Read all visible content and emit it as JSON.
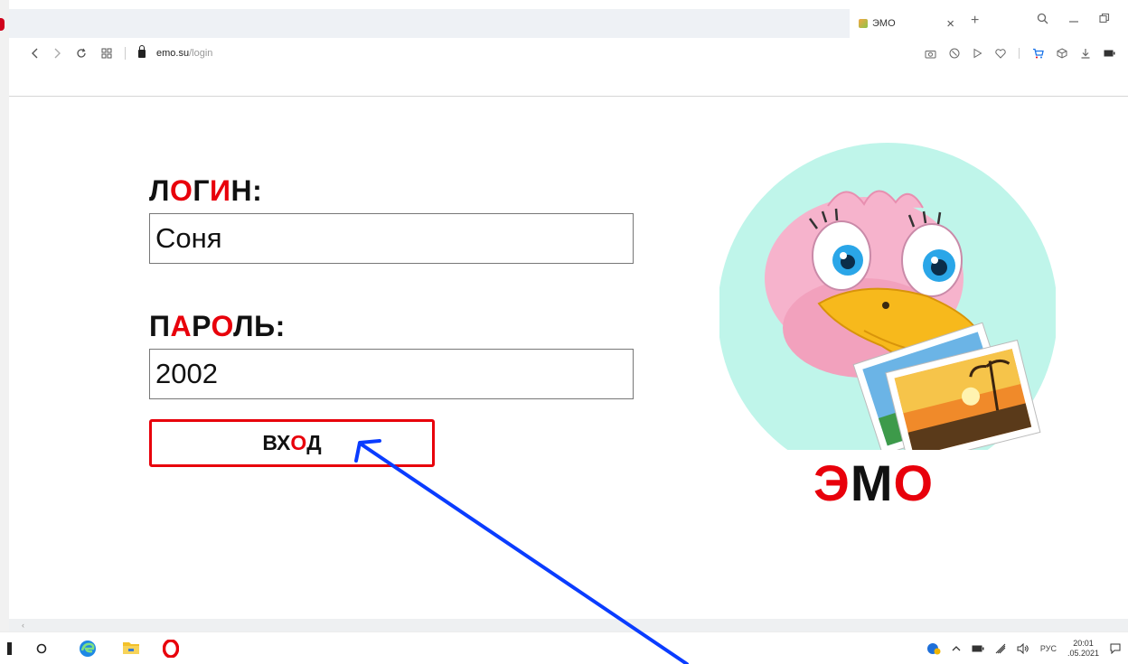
{
  "browser": {
    "tab_title": "ЭМО",
    "tab_close": "×",
    "new_tab": "+",
    "url_host": "emo.su",
    "url_path": "/login"
  },
  "form": {
    "login_label_parts": [
      "Л",
      "О",
      "Г",
      "И",
      "Н:"
    ],
    "login_value": "Соня",
    "password_label_parts": [
      "П",
      "А",
      "Р",
      "О",
      "ЛЬ:"
    ],
    "password_value": "2002",
    "button_parts": [
      "ВХ",
      "О",
      "Д"
    ]
  },
  "brand": {
    "parts": [
      "Э",
      "М",
      "О"
    ]
  },
  "tray": {
    "language": "РУС",
    "time": "20:01",
    "date": ".05.2021"
  },
  "colors": {
    "accent_red": "#e8000b",
    "arrow_blue": "#0a3cff",
    "logo_bg": "#bff5ea"
  }
}
